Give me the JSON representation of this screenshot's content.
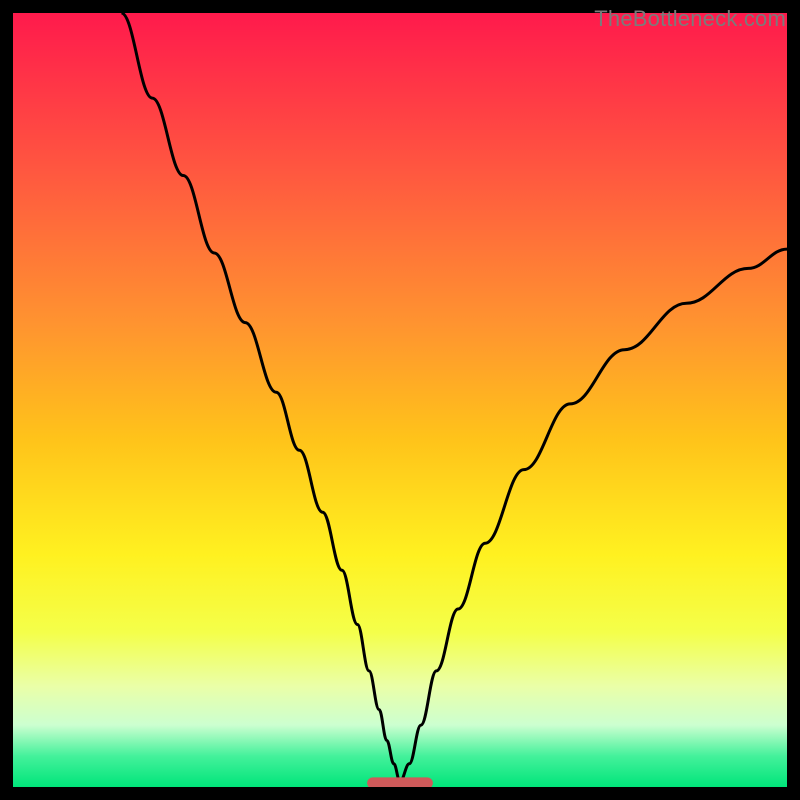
{
  "watermark": "TheBottleneck.com",
  "chart_data": {
    "type": "line",
    "title": "",
    "xlabel": "",
    "ylabel": "",
    "xlim": [
      0,
      100
    ],
    "ylim": [
      0,
      100
    ],
    "background_gradient": {
      "stops": [
        {
          "pos": 0.0,
          "color": "#ff1a4c"
        },
        {
          "pos": 0.2,
          "color": "#ff5640"
        },
        {
          "pos": 0.4,
          "color": "#ff9330"
        },
        {
          "pos": 0.55,
          "color": "#ffc31a"
        },
        {
          "pos": 0.7,
          "color": "#fff120"
        },
        {
          "pos": 0.8,
          "color": "#f4ff4a"
        },
        {
          "pos": 0.87,
          "color": "#eaffa8"
        },
        {
          "pos": 0.92,
          "color": "#ccffd0"
        },
        {
          "pos": 0.96,
          "color": "#44f19b"
        },
        {
          "pos": 1.0,
          "color": "#00e57a"
        }
      ]
    },
    "series": [
      {
        "name": "curve",
        "stroke": "#000000",
        "x": [
          14,
          18,
          22,
          26,
          30,
          34,
          37,
          40,
          42.5,
          44.5,
          46,
          47.3,
          48.3,
          49.2,
          50,
          51.2,
          52.7,
          54.7,
          57.5,
          61,
          66,
          72,
          79,
          87,
          95,
          100
        ],
        "y": [
          100,
          89,
          79,
          69,
          60,
          51,
          43.5,
          35.5,
          28,
          21,
          15,
          10,
          6,
          3,
          0.7,
          3,
          8,
          15,
          23,
          31.5,
          41,
          49.5,
          56.5,
          62.5,
          67,
          69.5
        ]
      }
    ],
    "marker": {
      "name": "baseline-marker",
      "shape": "pill",
      "x_center": 50,
      "y": 0.5,
      "width_x_units": 8.5,
      "height_y_units": 1.5,
      "fill": "#cf5a5a"
    }
  }
}
